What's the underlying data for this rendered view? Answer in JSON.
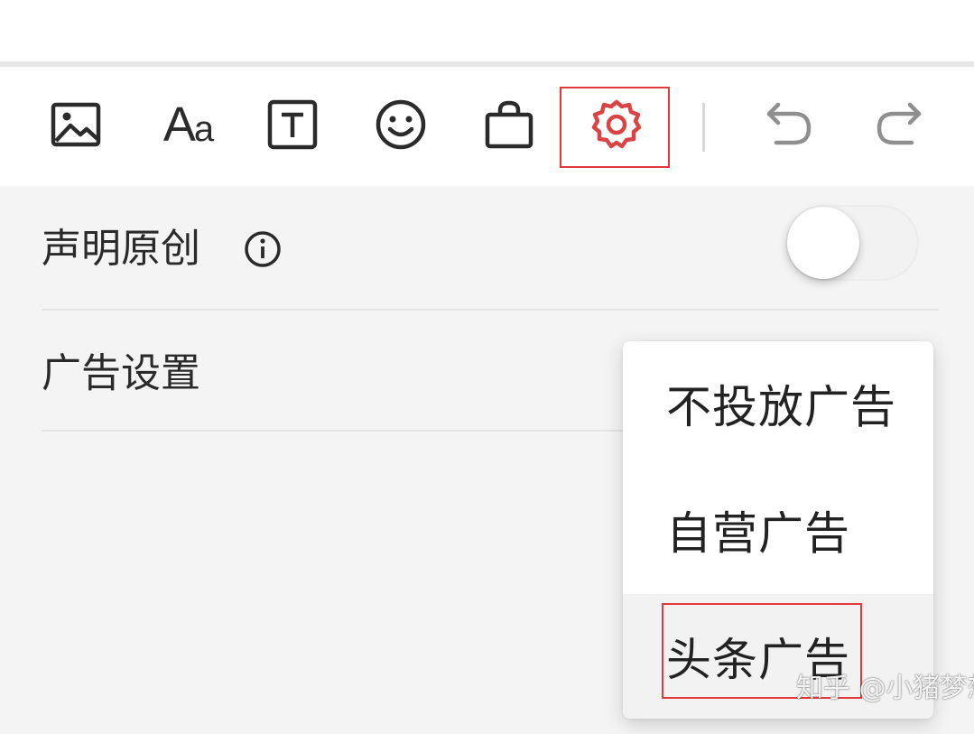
{
  "toolbar": {
    "items": [
      {
        "name": "image-icon"
      },
      {
        "name": "font-size-icon",
        "label": "Aa"
      },
      {
        "name": "text-box-icon"
      },
      {
        "name": "emoji-icon"
      },
      {
        "name": "shopping-bag-icon"
      },
      {
        "name": "settings-gear-icon",
        "highlighted": true
      },
      {
        "name": "undo-icon"
      },
      {
        "name": "redo-icon"
      }
    ]
  },
  "settings": {
    "original": {
      "label": "声明原创",
      "info_icon": "info-circle-icon",
      "toggle_on": false
    },
    "ads": {
      "label": "广告设置"
    }
  },
  "dropdown": {
    "options": [
      "不投放广告",
      "自营广告",
      "头条广告"
    ],
    "selected_index": 2
  },
  "watermark": {
    "text": "知乎 @小猪梦想"
  },
  "colors": {
    "highlight": "#e23a3a",
    "gear": "#d94545",
    "icon": "#2b2b2b",
    "disabled_icon": "#8f8f8f"
  }
}
